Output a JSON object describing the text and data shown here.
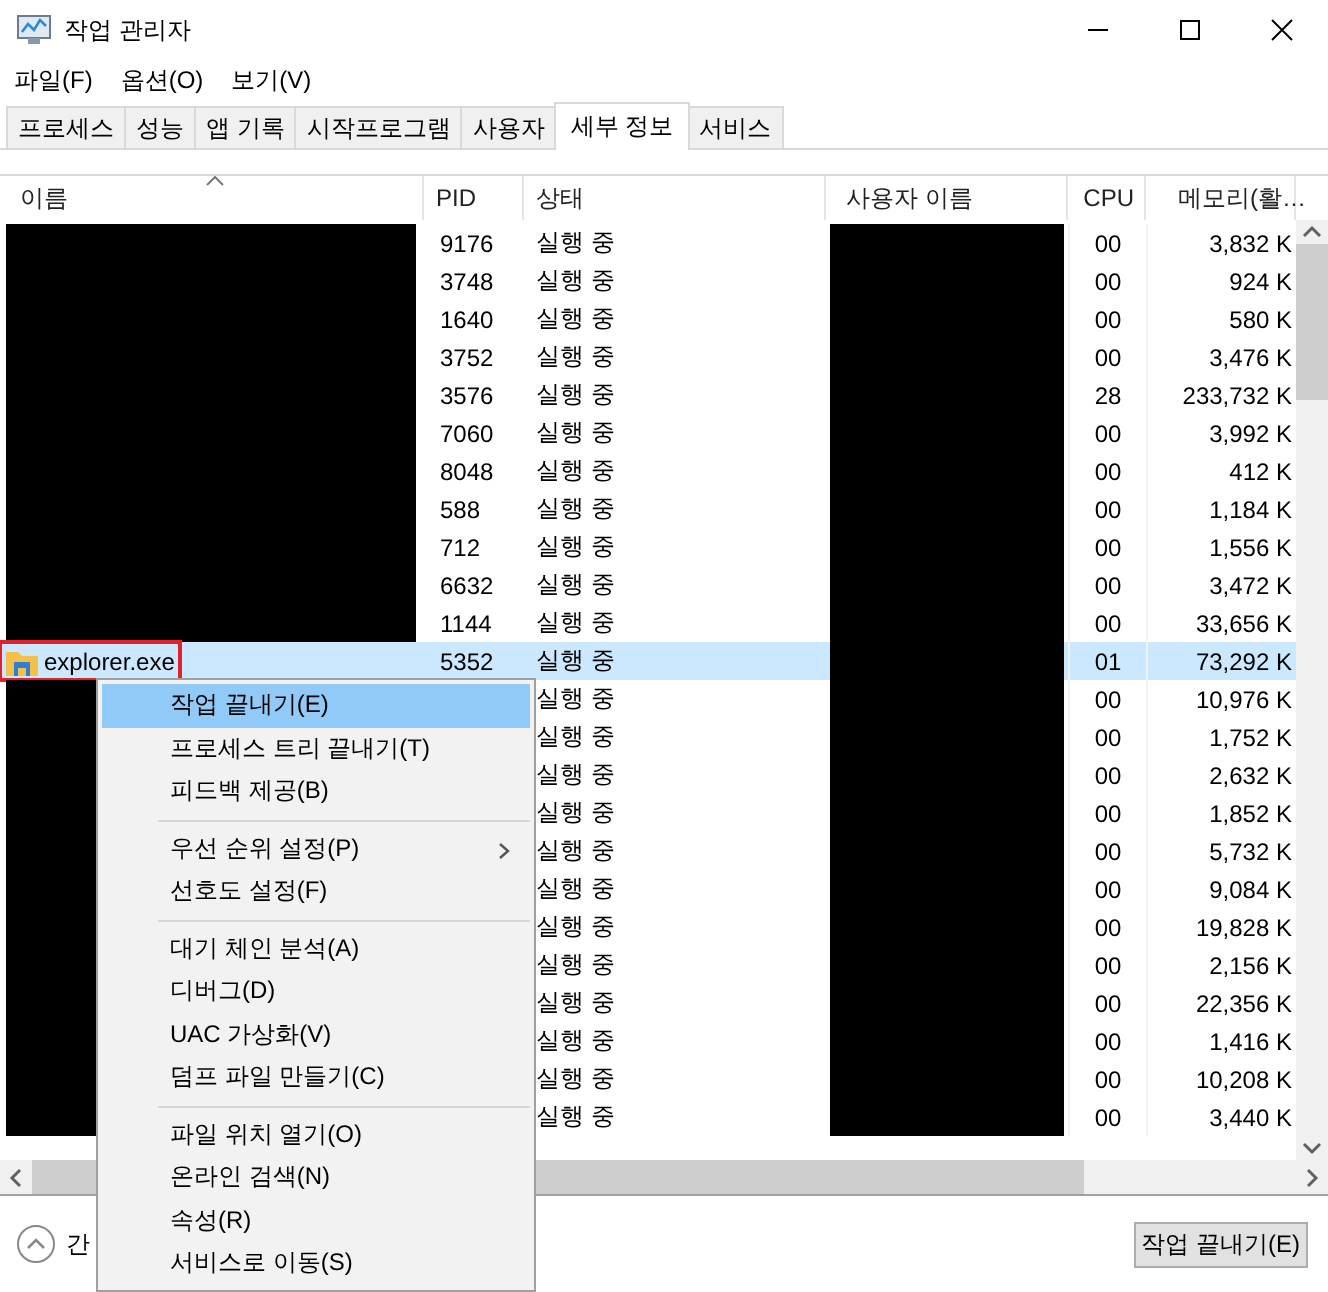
{
  "window": {
    "title": "작업 관리자"
  },
  "menu_bar": [
    "파일(F)",
    "옵션(O)",
    "보기(V)"
  ],
  "tabs": [
    {
      "label": "프로세스",
      "selected": false
    },
    {
      "label": "성능",
      "selected": false
    },
    {
      "label": "앱 기록",
      "selected": false
    },
    {
      "label": "시작프로그램",
      "selected": false
    },
    {
      "label": "사용자",
      "selected": false
    },
    {
      "label": "세부 정보",
      "selected": true
    },
    {
      "label": "서비스",
      "selected": false
    }
  ],
  "table": {
    "columns": [
      "이름",
      "PID",
      "상태",
      "사용자 이름",
      "CPU",
      "메모리(활…"
    ],
    "rows": [
      {
        "name_redacted": true,
        "pid": "9176",
        "status": "실행 중",
        "user_redacted": true,
        "cpu": "00",
        "memory": "3,832 K",
        "selected": false
      },
      {
        "name_redacted": true,
        "pid": "3748",
        "status": "실행 중",
        "user_redacted": true,
        "cpu": "00",
        "memory": "924 K",
        "selected": false
      },
      {
        "name_redacted": true,
        "pid": "1640",
        "status": "실행 중",
        "user_redacted": true,
        "cpu": "00",
        "memory": "580 K",
        "selected": false
      },
      {
        "name_redacted": true,
        "pid": "3752",
        "status": "실행 중",
        "user_redacted": true,
        "cpu": "00",
        "memory": "3,476 K",
        "selected": false
      },
      {
        "name_redacted": true,
        "pid": "3576",
        "status": "실행 중",
        "user_redacted": true,
        "cpu": "28",
        "memory": "233,732 K",
        "selected": false
      },
      {
        "name_redacted": true,
        "pid": "7060",
        "status": "실행 중",
        "user_redacted": true,
        "cpu": "00",
        "memory": "3,992 K",
        "selected": false
      },
      {
        "name_redacted": true,
        "pid": "8048",
        "status": "실행 중",
        "user_redacted": true,
        "cpu": "00",
        "memory": "412 K",
        "selected": false
      },
      {
        "name_redacted": true,
        "pid": "588",
        "status": "실행 중",
        "user_redacted": true,
        "cpu": "00",
        "memory": "1,184 K",
        "selected": false
      },
      {
        "name_redacted": true,
        "pid": "712",
        "status": "실행 중",
        "user_redacted": true,
        "cpu": "00",
        "memory": "1,556 K",
        "selected": false
      },
      {
        "name_redacted": true,
        "pid": "6632",
        "status": "실행 중",
        "user_redacted": true,
        "cpu": "00",
        "memory": "3,472 K",
        "selected": false
      },
      {
        "name_redacted": true,
        "pid": "1144",
        "status": "실행 중",
        "user_redacted": true,
        "cpu": "00",
        "memory": "33,656 K",
        "selected": false
      },
      {
        "name_redacted": false,
        "name": "explorer.exe",
        "highlighted": true,
        "pid": "5352",
        "status": "실행 중",
        "user_redacted": true,
        "cpu": "01",
        "memory": "73,292 K",
        "selected": true
      },
      {
        "name_redacted": true,
        "status": "실행 중",
        "user_redacted": true,
        "cpu": "00",
        "memory": "10,976 K",
        "selected": false
      },
      {
        "name_redacted": true,
        "status": "실행 중",
        "user_redacted": true,
        "cpu": "00",
        "memory": "1,752 K",
        "selected": false
      },
      {
        "name_redacted": true,
        "status": "실행 중",
        "user_redacted": true,
        "cpu": "00",
        "memory": "2,632 K",
        "selected": false
      },
      {
        "name_redacted": true,
        "status": "실행 중",
        "user_redacted": true,
        "cpu": "00",
        "memory": "1,852 K",
        "selected": false
      },
      {
        "name_redacted": true,
        "status": "실행 중",
        "user_redacted": true,
        "cpu": "00",
        "memory": "5,732 K",
        "selected": false
      },
      {
        "name_redacted": true,
        "status": "실행 중",
        "user_redacted": true,
        "cpu": "00",
        "memory": "9,084 K",
        "selected": false
      },
      {
        "name_redacted": true,
        "status": "실행 중",
        "user_redacted": true,
        "cpu": "00",
        "memory": "19,828 K",
        "selected": false
      },
      {
        "name_redacted": true,
        "status": "실행 중",
        "user_redacted": true,
        "cpu": "00",
        "memory": "2,156 K",
        "selected": false
      },
      {
        "name_redacted": true,
        "status": "실행 중",
        "user_redacted": true,
        "cpu": "00",
        "memory": "22,356 K",
        "selected": false
      },
      {
        "name_redacted": true,
        "status": "실행 중",
        "user_redacted": true,
        "cpu": "00",
        "memory": "1,416 K",
        "selected": false
      },
      {
        "name_redacted": true,
        "status": "실행 중",
        "user_redacted": true,
        "cpu": "00",
        "memory": "10,208 K",
        "selected": false
      },
      {
        "name_redacted": true,
        "status": "실행 중",
        "user_redacted": true,
        "cpu": "00",
        "memory": "3,440 K",
        "selected": false
      }
    ]
  },
  "context_menu": {
    "groups": [
      [
        {
          "label": "작업 끝내기(E)",
          "selected": true,
          "submenu": false
        },
        {
          "label": "프로세스 트리 끝내기(T)",
          "selected": false,
          "submenu": false
        },
        {
          "label": "피드백 제공(B)",
          "selected": false,
          "submenu": false
        }
      ],
      [
        {
          "label": "우선 순위 설정(P)",
          "selected": false,
          "submenu": true
        },
        {
          "label": "선호도 설정(F)",
          "selected": false,
          "submenu": false
        }
      ],
      [
        {
          "label": "대기 체인 분석(A)",
          "selected": false,
          "submenu": false
        },
        {
          "label": "디버그(D)",
          "selected": false,
          "submenu": false
        },
        {
          "label": "UAC 가상화(V)",
          "selected": false,
          "submenu": false
        },
        {
          "label": "덤프 파일 만들기(C)",
          "selected": false,
          "submenu": false
        }
      ],
      [
        {
          "label": "파일 위치 열기(O)",
          "selected": false,
          "submenu": false
        },
        {
          "label": "온라인 검색(N)",
          "selected": false,
          "submenu": false
        },
        {
          "label": "속성(R)",
          "selected": false,
          "submenu": false
        },
        {
          "label": "서비스로 이동(S)",
          "selected": false,
          "submenu": false
        }
      ]
    ]
  },
  "footer": {
    "toggle_label": "간",
    "button": "작업 끝내기(E)"
  }
}
